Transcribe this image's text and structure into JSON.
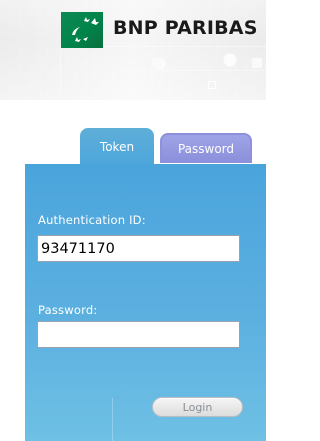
{
  "brand": {
    "name": "BNP PARIBAS",
    "logo_color": "#00844a"
  },
  "tabs": [
    {
      "label": "Token",
      "active": true,
      "color": "#4da6db"
    },
    {
      "label": "Password",
      "active": false,
      "color": "#8b8fdb"
    }
  ],
  "form": {
    "auth_label": "Authentication ID:",
    "auth_value": "93471170",
    "password_label": "Password:",
    "password_value": "",
    "login_label": "Login"
  },
  "colors": {
    "panel": "#4da6db",
    "text": "#ffffff"
  }
}
